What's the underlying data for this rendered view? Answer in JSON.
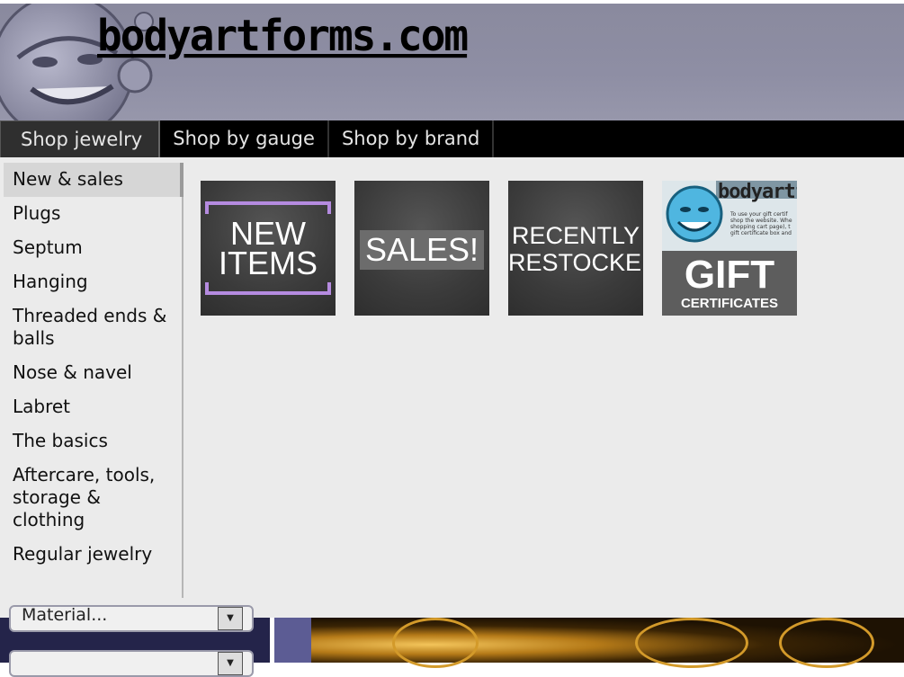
{
  "site": {
    "logo_text": "bodyartforms.com"
  },
  "nav": {
    "tabs": [
      {
        "label": "Shop jewelry",
        "active": true
      },
      {
        "label": "Shop by gauge",
        "active": false
      },
      {
        "label": "Shop by brand",
        "active": false
      }
    ]
  },
  "menu": {
    "categories": [
      {
        "label": "New & sales",
        "active": true
      },
      {
        "label": "Plugs"
      },
      {
        "label": "Septum"
      },
      {
        "label": "Hanging"
      },
      {
        "label": "Threaded ends & balls"
      },
      {
        "label": "Nose & navel"
      },
      {
        "label": "Labret"
      },
      {
        "label": "The basics"
      },
      {
        "label": "Aftercare, tools, storage & clothing"
      },
      {
        "label": "Regular jewelry"
      }
    ],
    "tiles": {
      "new_items": {
        "line1": "NEW",
        "line2": "ITEMS"
      },
      "sales": {
        "label": "SALES!"
      },
      "restocked": {
        "line1": "RECENTLY",
        "line2": "RESTOCKED"
      },
      "gift": {
        "brand": "bodyartf",
        "fine_print": "To use your gift certif shop the website. Whe shopping cart page), t gift certificate box and",
        "title": "GIFT",
        "subtitle": "CERTIFICATES"
      }
    }
  },
  "sidebar": {
    "material_select": "Material..."
  },
  "colors": {
    "accent_purple": "#b58be0",
    "nav_bg": "#000000",
    "header_bg": "#8e8ea4"
  }
}
